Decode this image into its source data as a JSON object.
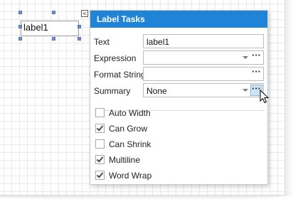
{
  "designer": {
    "label_control_text": "label1",
    "smart_tag_glyph": "<"
  },
  "panel": {
    "title": "Label Tasks",
    "fields": [
      {
        "label": "Text",
        "value": "label1",
        "has_dropdown": false,
        "has_ellipsis": false
      },
      {
        "label": "Expression",
        "value": "",
        "has_dropdown": true,
        "has_ellipsis": true
      },
      {
        "label": "Format String",
        "value": "",
        "has_dropdown": false,
        "has_ellipsis": true
      },
      {
        "label": "Summary",
        "value": "None",
        "has_dropdown": true,
        "has_ellipsis": true
      }
    ],
    "ellipsis_glyph": "···",
    "options": [
      {
        "label": "Auto Width",
        "checked": false
      },
      {
        "label": "Can Grow",
        "checked": true
      },
      {
        "label": "Can Shrink",
        "checked": false
      },
      {
        "label": "Multiline",
        "checked": true
      },
      {
        "label": "Word Wrap",
        "checked": true
      }
    ]
  },
  "colors": {
    "header": "#1f83d6",
    "handle": "#6f8fc8",
    "ellipsis_active": "#cfe3f6"
  },
  "icons": {
    "cursor": "arrow-cursor-icon",
    "dropdown": "chevron-down-icon",
    "ellipsis": "ellipsis-icon",
    "smart_tag": "smart-tag-icon"
  }
}
